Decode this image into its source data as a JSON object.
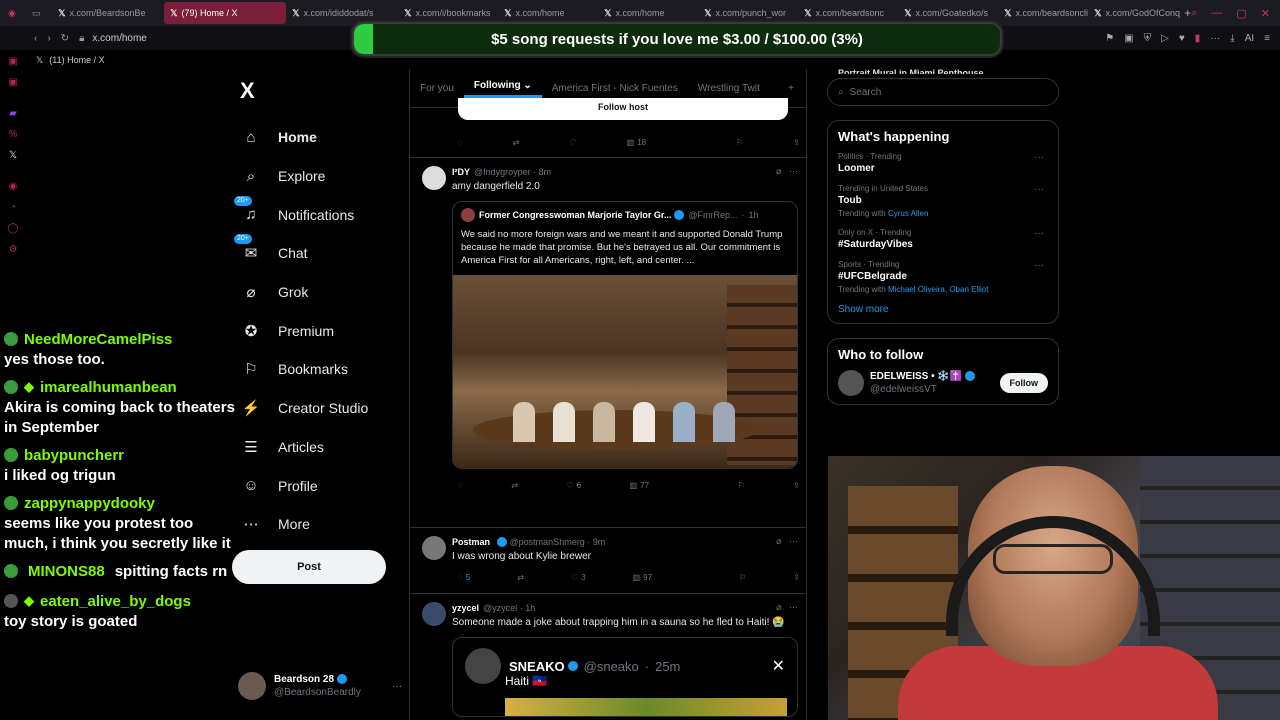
{
  "browser": {
    "tabs": [
      {
        "label": "x.com/BeardsonBe",
        "active": false
      },
      {
        "label": "(79) Home / X",
        "active": true
      },
      {
        "label": "x.com/ididdodat/s",
        "active": false
      },
      {
        "label": "x.com/i/bookmarks",
        "active": false
      },
      {
        "label": "x.com/home",
        "active": false
      },
      {
        "label": "x.com/home",
        "active": false
      },
      {
        "label": "x.com/punch_wor",
        "active": false
      },
      {
        "label": "x.com/beardsonc",
        "active": false
      },
      {
        "label": "x.com/Goatedko/s",
        "active": false
      },
      {
        "label": "x.com/beardsoncli",
        "active": false
      },
      {
        "label": "x.com/GodOfConq",
        "active": false
      }
    ],
    "address": "x.com/home",
    "page_title": "(11) Home / X",
    "ai_label": "AI"
  },
  "donation": {
    "text": "$5 song requests if you love me $3.00 / $100.00 (3%)",
    "progress": 0.03,
    "color": "#2ecc40"
  },
  "sidebar": {
    "logo": "X",
    "items": [
      {
        "label": "Home",
        "icon": "home-icon"
      },
      {
        "label": "Explore",
        "icon": "search-icon"
      },
      {
        "label": "Notifications",
        "icon": "bell-icon",
        "badge": "20+"
      },
      {
        "label": "Chat",
        "icon": "mail-icon",
        "badge": "20+"
      },
      {
        "label": "Grok",
        "icon": "grok-icon"
      },
      {
        "label": "Premium",
        "icon": "premium-icon"
      },
      {
        "label": "Bookmarks",
        "icon": "bookmark-icon"
      },
      {
        "label": "Creator Studio",
        "icon": "creator-icon"
      },
      {
        "label": "Articles",
        "icon": "articles-icon"
      },
      {
        "label": "Profile",
        "icon": "person-icon"
      },
      {
        "label": "More",
        "icon": "more-icon"
      }
    ],
    "post_label": "Post",
    "account": {
      "name": "Beardson 28",
      "handle": "@BeardsonBeardly"
    }
  },
  "chat": [
    {
      "user": "NeedMoreCamelPiss",
      "text": "yes those too."
    },
    {
      "user": "imarealhumanbean",
      "text": "Akira is coming back to theaters in September"
    },
    {
      "user": "babypuncherr",
      "text": "i liked og trigun"
    },
    {
      "user": "zappynappydooky",
      "text": "seems like you protest too much, i think you secretly like it"
    },
    {
      "user": "MINONS88",
      "text": "spitting facts rn"
    },
    {
      "user": "eaten_alive_by_dogs",
      "text": "toy story is goated"
    }
  ],
  "feed": {
    "tabs": [
      "For you",
      "Following",
      "America First - Nick Fuentes",
      "Wrestling Twit",
      "+"
    ],
    "follow_host": "Follow host",
    "top_actions": {
      "likes": "",
      "views": "18"
    },
    "tweet1": {
      "name": "I²DY",
      "handle": "@Indygroyper",
      "time": "8m",
      "text": "amy dangerfield 2.0",
      "quote": {
        "name": "Former Congresswoman Marjorie Taylor Gr...",
        "handle": "@FmrRep...",
        "time": "1h",
        "text": "We said no more foreign wars and we meant it and supported Donald Trump because he made that promise. But he's betrayed us all. Our commitment is America First for all Americans, right, left, and center. ..."
      },
      "likes": "6",
      "views": "77"
    },
    "tweet2": {
      "name": "Postman",
      "handle": "@postmanShmerg",
      "time": "9m",
      "text": "I was wrong about Kylie brewer",
      "replies": "5",
      "likes": "3",
      "views": "97"
    },
    "tweet3": {
      "name": "yzycel",
      "handle": "@yzycel",
      "time": "1h",
      "text": "Someone made a joke about trapping him in a sauna so he fled to Haiti! 😭",
      "quote": {
        "name": "SNEAKO",
        "handle": "@sneako",
        "time": "25m",
        "text": "Haiti 🇭🇹"
      }
    }
  },
  "right": {
    "clipped_top": "Portrait Mural in Miami Penthouse",
    "search_placeholder": "Search",
    "whats_happening": "What's happening",
    "trends": [
      {
        "context": "Politics · Trending",
        "name": "Loomer",
        "with": ""
      },
      {
        "context": "Trending in United States",
        "name": "Toub",
        "with_prefix": "Trending with",
        "with": "Cyrus Allen"
      },
      {
        "context": "Only on X · Trending",
        "name": "#SaturdayVibes",
        "with": ""
      },
      {
        "context": "Sports · Trending",
        "name": "#UFCBelgrade",
        "with_prefix": "Trending with",
        "with": "Michael Oliveira, Oban Elliot"
      }
    ],
    "show_more": "Show more",
    "who_to_follow": "Who to follow",
    "suggestion": {
      "name": "EDELWEISS • ❄️✝️",
      "handle": "@edelweissVT",
      "button": "Follow"
    }
  }
}
